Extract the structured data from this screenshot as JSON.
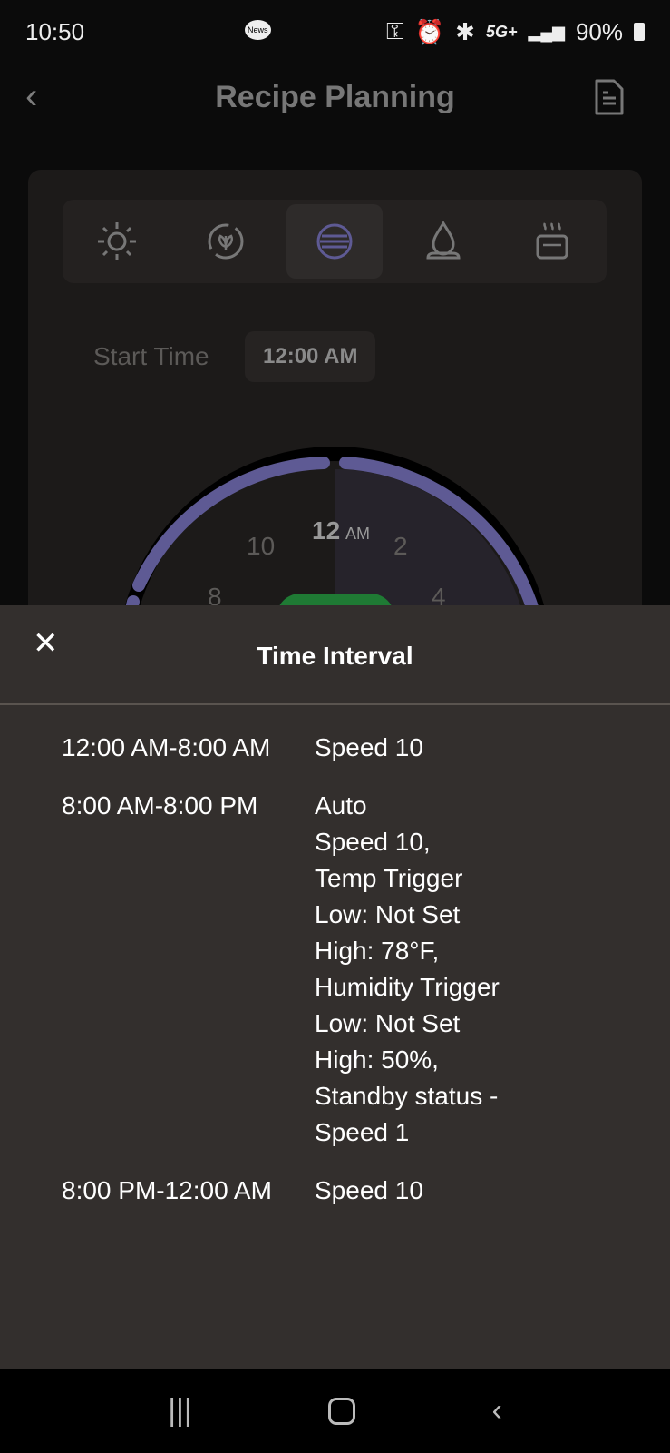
{
  "status_bar": {
    "time": "10:50",
    "network": "5G+",
    "battery": "90%",
    "news_badge": "News"
  },
  "header": {
    "title": "Recipe Planning"
  },
  "mode_tabs": [
    {
      "icon": "sun-icon"
    },
    {
      "icon": "recycle-leaf-icon"
    },
    {
      "icon": "speed-lines-icon",
      "active": true
    },
    {
      "icon": "humidity-drop-icon"
    },
    {
      "icon": "heater-icon"
    }
  ],
  "start_time": {
    "label": "Start Time",
    "value": "12:00 AM"
  },
  "clock": {
    "labels": [
      "12",
      "AM",
      "10",
      "2",
      "8",
      "4"
    ]
  },
  "sheet": {
    "title": "Time Interval",
    "intervals": [
      {
        "time": "12:00 AM-8:00 AM",
        "detail": "Speed 10"
      },
      {
        "time": "8:00 AM-8:00 PM",
        "detail": "Auto\nSpeed 10,\nTemp Trigger\nLow: Not Set\nHigh: 78°F,\nHumidity Trigger\nLow: Not Set\nHigh: 50%,\nStandby status -\nSpeed 1"
      },
      {
        "time": "8:00 PM-12:00 AM",
        "detail": "Speed 10"
      }
    ]
  },
  "colors": {
    "accent": "#5e5a94",
    "green": "#1f7a34",
    "sheet_bg": "#332f2d"
  }
}
